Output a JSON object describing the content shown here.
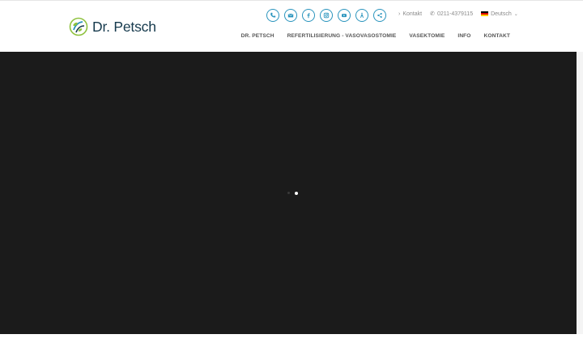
{
  "logo": {
    "text": "Dr. Petsch"
  },
  "social": [
    {
      "icon": "phone-icon",
      "glyph": "☎"
    },
    {
      "icon": "envelope-icon",
      "glyph": "✉"
    },
    {
      "icon": "facebook-icon",
      "glyph": "f"
    },
    {
      "icon": "instagram-icon",
      "glyph": "◎"
    },
    {
      "icon": "youtube-icon",
      "glyph": "▶"
    },
    {
      "icon": "accessibility-icon",
      "glyph": "Å"
    },
    {
      "icon": "share-icon",
      "glyph": "⋖"
    }
  ],
  "meta": {
    "kontakt_label": "Kontakt",
    "phone": "0211-4379115",
    "language": "Deutsch"
  },
  "nav": {
    "items": [
      "DR. PETSCH",
      "REFERTILISIERUNG - VASOVASOSTOMIE",
      "VASEKTOMIE",
      "INFO",
      "KONTAKT"
    ]
  },
  "colors": {
    "accent": "#2a94bd",
    "logo_text": "#163a4d",
    "hero_bg": "#1b1b1b"
  }
}
